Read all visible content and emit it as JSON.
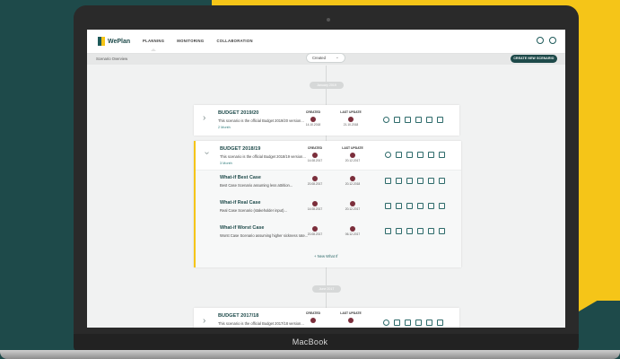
{
  "device": {
    "label": "MacBook"
  },
  "app": {
    "logo": "WePlan",
    "nav": [
      "PLANNING",
      "MONITORING",
      "COLLABORATION"
    ],
    "subbar_title": "Scenario Overview",
    "filter_value": "Created",
    "create_button": "CREATE NEW SCENARIO"
  },
  "timeline": {
    "top_label": "January 2019",
    "mid_label": "June 2017"
  },
  "scenarios": [
    {
      "title": "BUDGET 2019/20",
      "desc": "This scenario is the official Budget 2019/20 version...",
      "link": "2 Month",
      "created_h": "CREATED",
      "created_d": "14.10.2018",
      "updated_h": "LAST UPDATE",
      "updated_d": "21.10.2018"
    },
    {
      "title": "BUDGET 2018/19",
      "desc": "This scenario is the official Budget 2018/19 version...",
      "link": "3 Month",
      "created_h": "CREATED",
      "created_d": "14.08.2017",
      "updated_h": "LAST UPDATE",
      "updated_d": "20.12.2017"
    },
    {
      "title": "BUDGET 2017/18",
      "desc": "This scenario is the official Budget 2017/18 version...",
      "created_h": "CREATED",
      "updated_h": "LAST UPDATE"
    }
  ],
  "whatifs": [
    {
      "title": "What-if Best Case",
      "desc": "Best Case Scenario assuming less attrition...",
      "created_d": "20.08.2017",
      "updated_d": "20.12.2018"
    },
    {
      "title": "What-if Real Case",
      "desc": "Real Case Scenario (stakeholder input)...",
      "created_d": "14.08.2017",
      "updated_d": "20.12.2017"
    },
    {
      "title": "What-if Worst Case",
      "desc": "Worst Case Scenario assuming higher sickness rate...",
      "created_d": "20.08.2017",
      "updated_d": "06.12.2017"
    }
  ],
  "new_whatif": "+ New What If",
  "colors": {
    "teal": "#1e4a4a",
    "yellow": "#f5c518",
    "avatar": "#7b2e3b"
  }
}
